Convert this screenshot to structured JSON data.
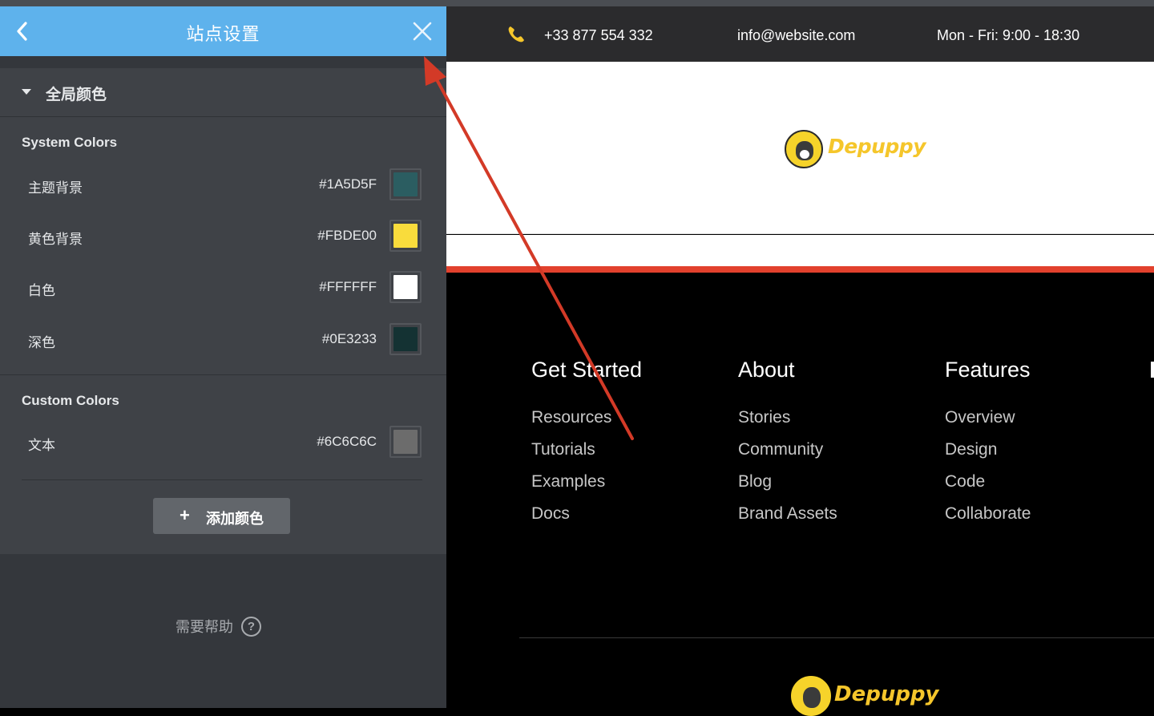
{
  "panel": {
    "title": "站点设置",
    "section_label": "全局颜色",
    "system_colors_title": "System Colors",
    "system_colors": [
      {
        "name": "主题背景",
        "hex": "#1A5D5F",
        "color": "#2b5d61"
      },
      {
        "name": "黄色背景",
        "hex": "#FBDE00",
        "color": "#f9dc3c"
      },
      {
        "name": "白色",
        "hex": "#FFFFFF",
        "color": "#ffffff"
      },
      {
        "name": "深色",
        "hex": "#0E3233",
        "color": "#143233"
      }
    ],
    "custom_colors_title": "Custom Colors",
    "custom_colors": [
      {
        "name": "文本",
        "hex": "#6C6C6C",
        "color": "#6c6c6c"
      }
    ],
    "add_color_plus": "+",
    "add_color_label": "添加颜色",
    "help_label": "需要帮助",
    "help_icon_glyph": "?"
  },
  "site": {
    "phone": "+33 877 554 332",
    "email": "info@website.com",
    "hours": "Mon - Fri: 9:00 - 18:30",
    "logo_text": "Depuppy",
    "footer_columns": [
      {
        "title": "Get Started",
        "links": [
          "Resources",
          "Tutorials",
          "Examples",
          "Docs"
        ]
      },
      {
        "title": "About",
        "links": [
          "Stories",
          "Community",
          "Blog",
          "Brand Assets"
        ]
      },
      {
        "title": "Features",
        "links": [
          "Overview",
          "Design",
          "Code",
          "Collaborate"
        ]
      }
    ]
  },
  "colors": {
    "header_blue": "#5eb2ec",
    "panel_bg": "#3f4247",
    "accent_red": "#e2412d",
    "brand_yellow": "#f5c62b"
  }
}
